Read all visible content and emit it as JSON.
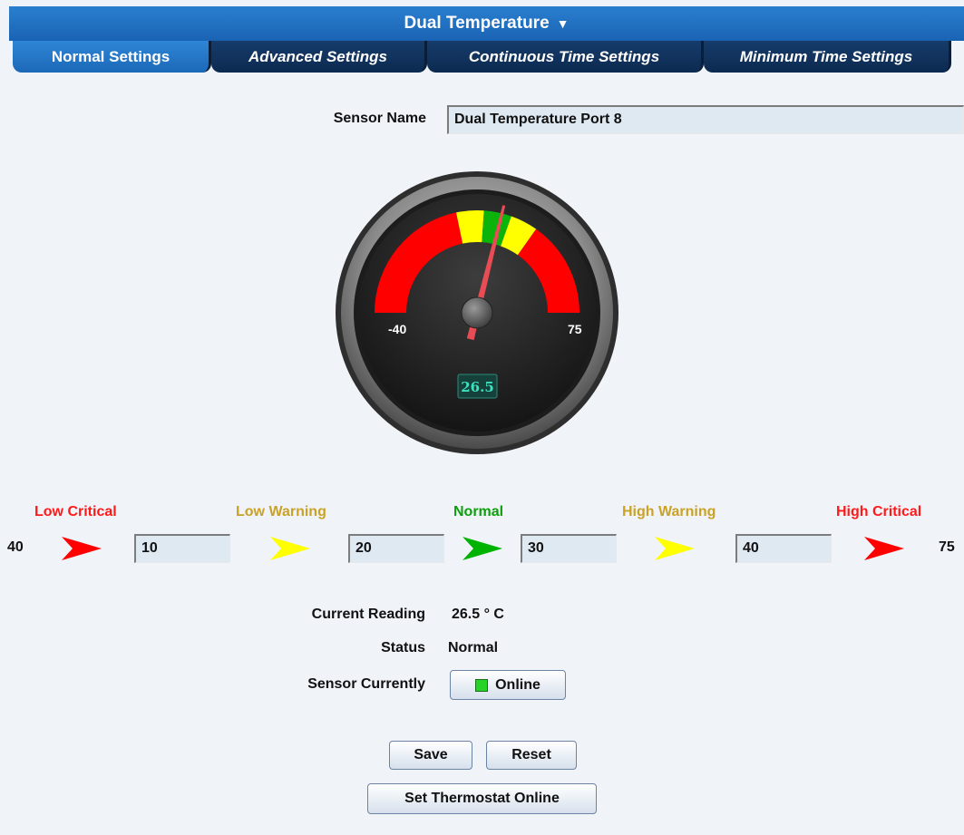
{
  "window": {
    "title": "Dual Temperature",
    "title_arrow": "▼"
  },
  "tabs": [
    {
      "label": "Normal Settings",
      "active": true
    },
    {
      "label": "Advanced Settings",
      "active": false
    },
    {
      "label": "Continuous Time Settings",
      "active": false
    },
    {
      "label": "Minimum Time Settings",
      "active": false
    }
  ],
  "sensor": {
    "name_label": "Sensor Name",
    "name_value": "Dual Temperature Port 8"
  },
  "gauge": {
    "min_label": "-40",
    "max_label": "75",
    "min": -40,
    "max": 75,
    "value": 26.5,
    "value_text": "26.5",
    "zone_colors": {
      "critical": "#ff0000",
      "warning": "#ffff00",
      "normal": "#0bb30b"
    }
  },
  "thresholds": {
    "min_value": "40",
    "max_value": "75",
    "low_critical": {
      "label": "Low Critical",
      "value": "10",
      "color": "#ff1a1a"
    },
    "low_warning": {
      "label": "Low Warning",
      "value": "20",
      "color": "#c9a227"
    },
    "normal": {
      "label": "Normal",
      "value": "30",
      "color": "#0e9e0e"
    },
    "high_warning": {
      "label": "High Warning",
      "value": "40",
      "color": "#c9a227"
    },
    "high_critical": {
      "label": "High Critical",
      "color": "#ff1a1a"
    },
    "arrow_colors": [
      "#ff0000",
      "#ffff00",
      "#00b300",
      "#ffff00",
      "#ff0000"
    ]
  },
  "status": {
    "current_reading_label": "Current Reading",
    "current_reading_value": "26.5 ° C",
    "status_label": "Status",
    "status_value": "Normal",
    "sensor_currently_label": "Sensor Currently",
    "online_button": "Online"
  },
  "buttons": {
    "save": "Save",
    "reset": "Reset",
    "set_thermostat_online": "Set Thermostat Online"
  }
}
